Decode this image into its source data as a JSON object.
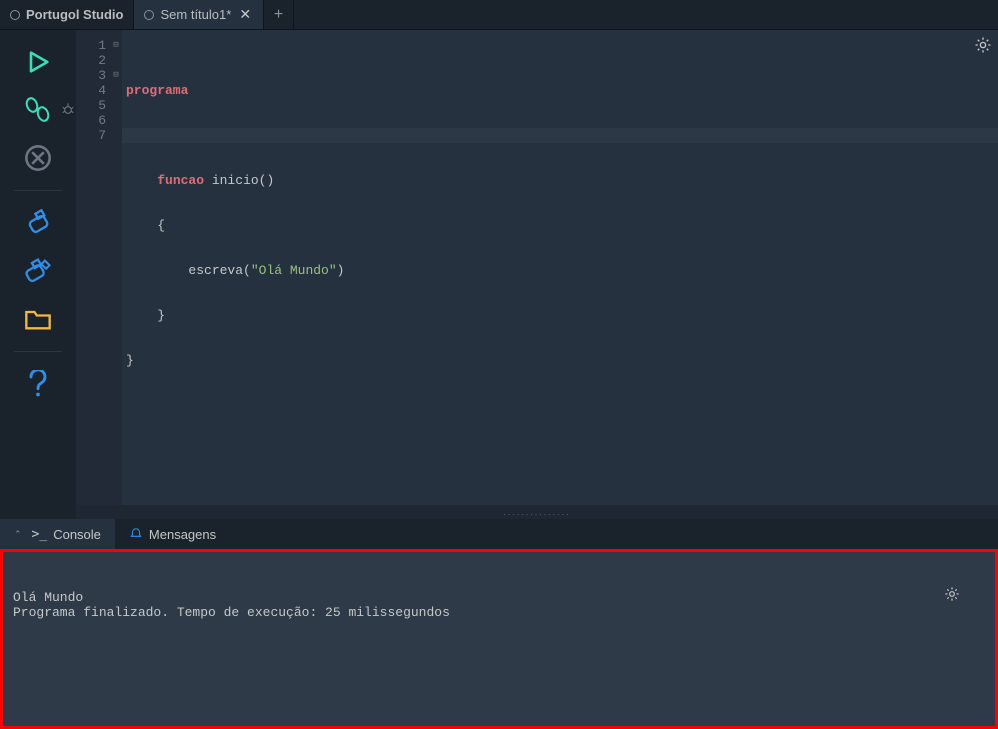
{
  "tabs": {
    "home": "Portugol Studio",
    "file": "Sem título1*"
  },
  "bottomTabs": {
    "console": "Console",
    "messages": "Mensagens"
  },
  "code": {
    "l1": {
      "programa": "programa"
    },
    "l2": {
      "brace": "{"
    },
    "l3": {
      "funcao": "funcao",
      "name": " inicio",
      "paren": "()"
    },
    "l4": {
      "brace": "    {"
    },
    "l5": {
      "indent": "        ",
      "call": "escreva",
      "open": "(",
      "str": "\"Olá Mundo\"",
      "close": ")"
    },
    "l6": {
      "brace": "    }"
    },
    "l7": {
      "brace": "}"
    }
  },
  "gutter": [
    "1",
    "2",
    "3",
    "4",
    "5",
    "6",
    "7"
  ],
  "console": {
    "line1": "Olá Mundo",
    "line2": "Programa finalizado. Tempo de execução: 25 milissegundos"
  },
  "splitter": "..............."
}
